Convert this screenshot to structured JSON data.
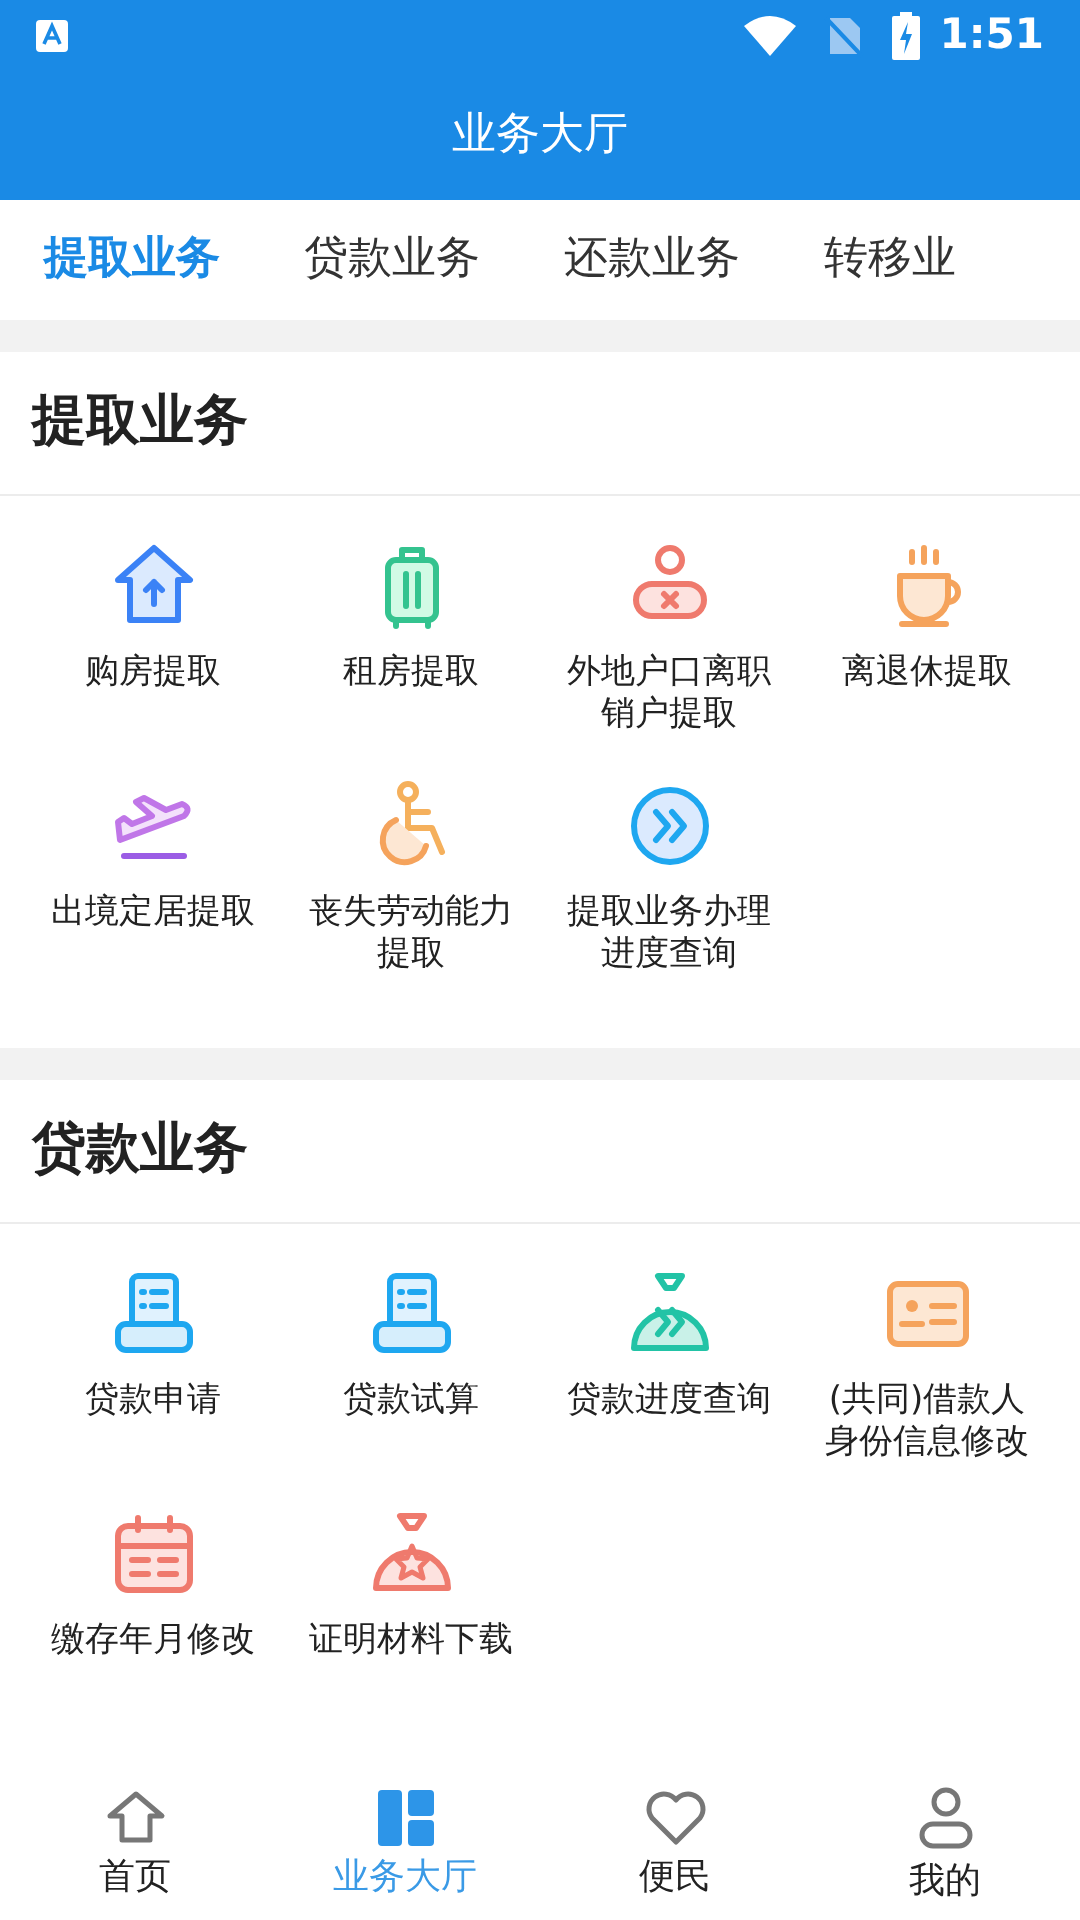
{
  "status_bar": {
    "time": "1:51"
  },
  "header": {
    "title": "业务大厅"
  },
  "tabs": [
    {
      "label": "提取业务",
      "selected": true
    },
    {
      "label": "贷款业务",
      "selected": false
    },
    {
      "label": "还款业务",
      "selected": false
    },
    {
      "label": "转移业",
      "selected": false
    }
  ],
  "sections": [
    {
      "title": "提取业务",
      "items": [
        {
          "label": "购房提取"
        },
        {
          "label": "租房提取"
        },
        {
          "label": "外地户口离职销户提取"
        },
        {
          "label": "离退休提取"
        },
        {
          "label": "出境定居提取"
        },
        {
          "label": "丧失劳动能力提取"
        },
        {
          "label": "提取业务办理进度查询"
        }
      ]
    },
    {
      "title": "贷款业务",
      "items": [
        {
          "label": "贷款申请"
        },
        {
          "label": "贷款试算"
        },
        {
          "label": "贷款进度查询"
        },
        {
          "label": "(共同)借款人身份信息修改"
        },
        {
          "label": "缴存年月修改"
        },
        {
          "label": "证明材料下载"
        }
      ]
    }
  ],
  "bottom_nav": [
    {
      "label": "首页",
      "selected": false
    },
    {
      "label": "业务大厅",
      "selected": true
    },
    {
      "label": "便民",
      "selected": false
    },
    {
      "label": "我的",
      "selected": false
    }
  ]
}
